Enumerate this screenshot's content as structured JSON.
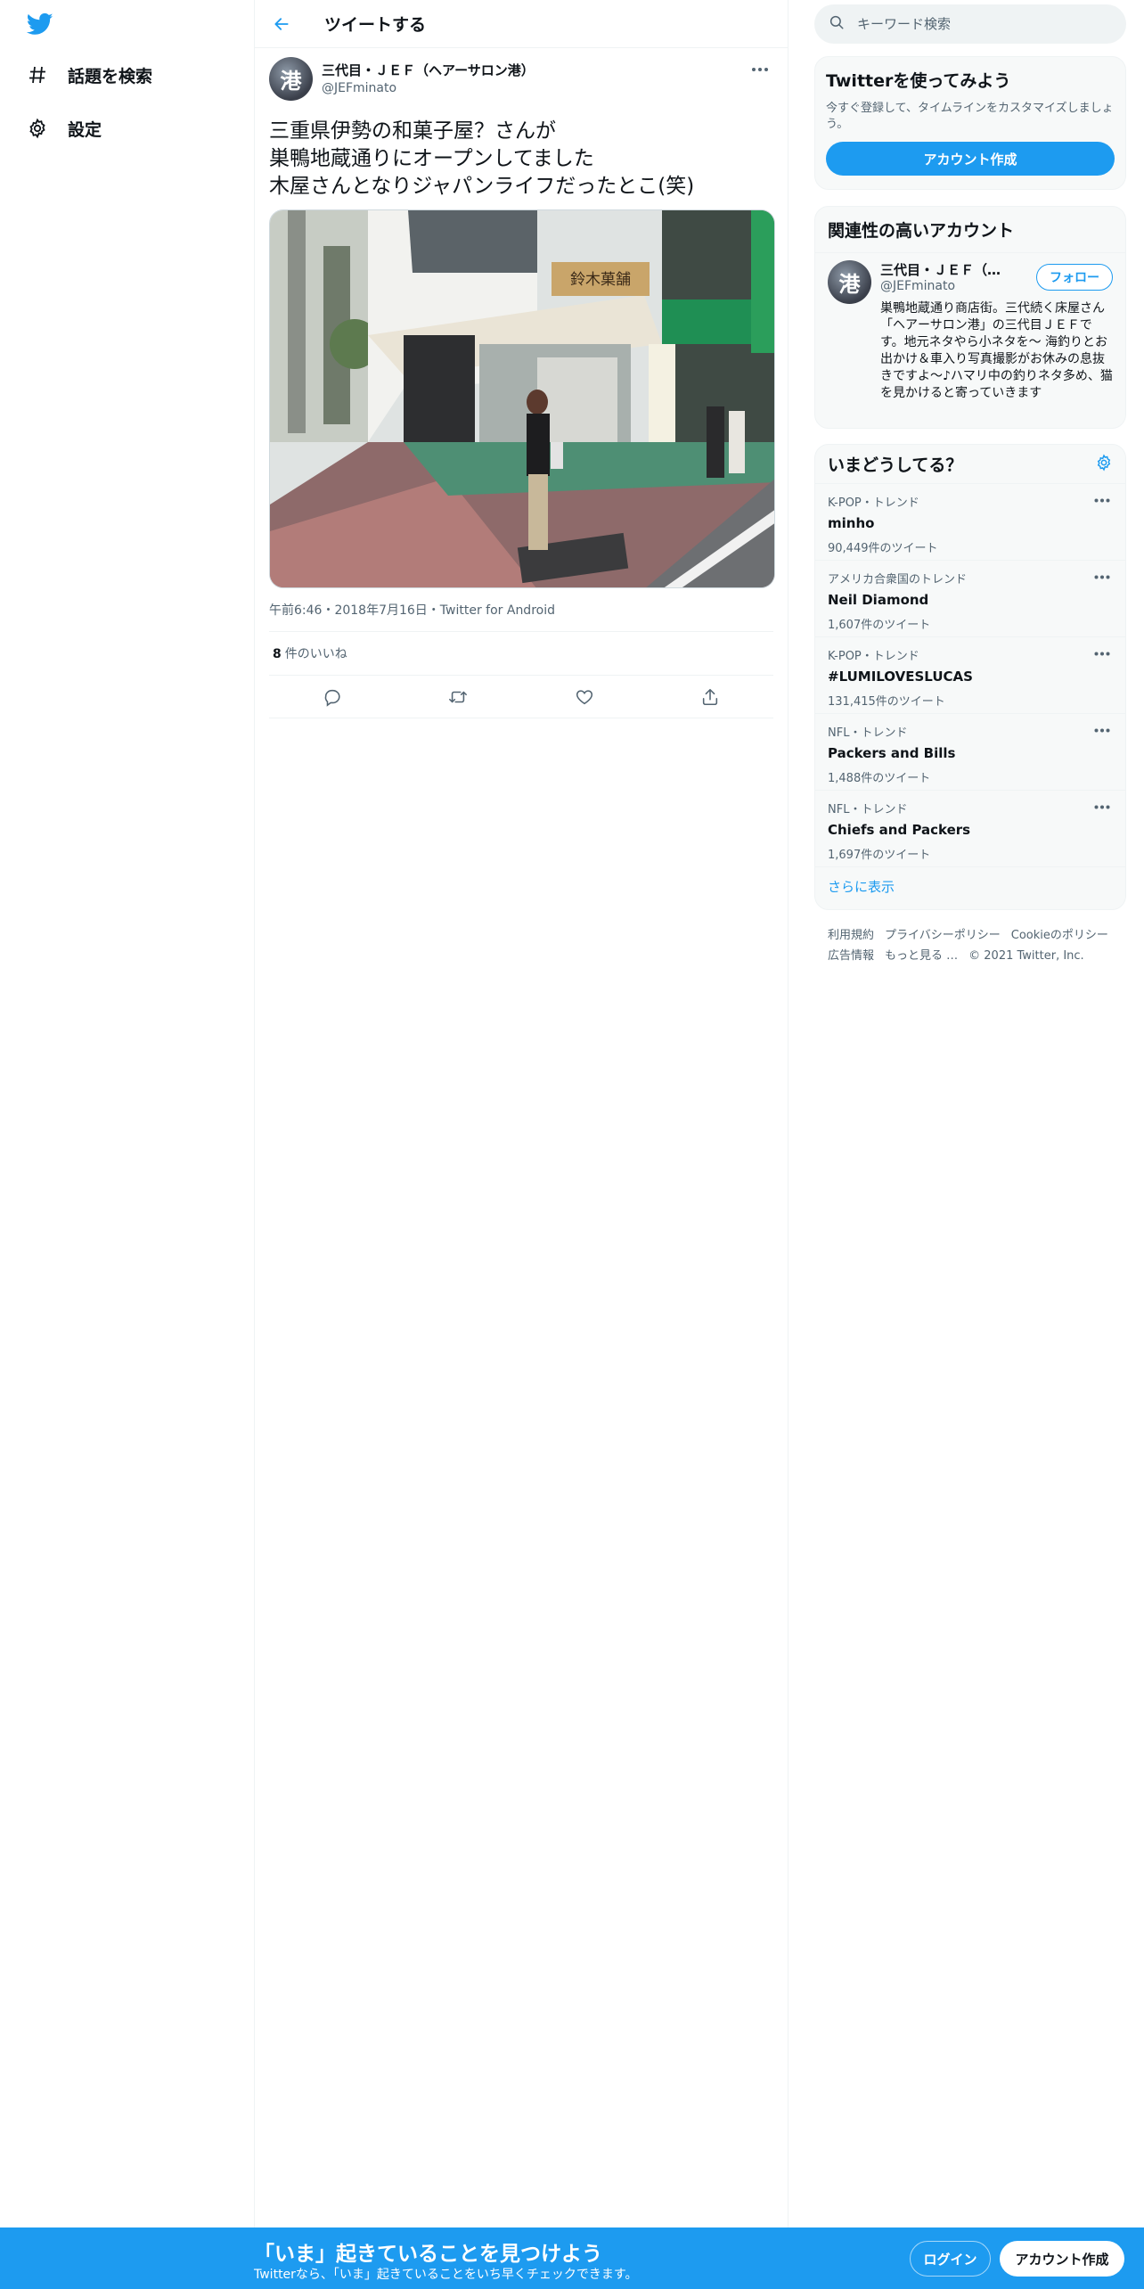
{
  "colors": {
    "accent": "#1d9bf0",
    "text": "#0f1419",
    "muted": "#536471",
    "border": "#eff3f4"
  },
  "nav": {
    "logo_icon": "twitter-bird-icon",
    "items": [
      {
        "icon": "hashtag-icon",
        "label": "話題を検索"
      },
      {
        "icon": "gear-icon",
        "label": "設定"
      }
    ]
  },
  "header": {
    "back_icon": "arrow-left-icon",
    "title": "ツイートする"
  },
  "tweet": {
    "avatar_text": "港",
    "display_name": "三代目・ＪＥＦ（ヘアーサロン港）",
    "handle": "@JEFminato",
    "text": "三重県伊勢の和菓子屋？さんが\n巣鴨地蔵通りにオープンしてました\n木屋さんとなりジャパンライフだったとこ(笑)",
    "photo_sign": "鈴木菓舗",
    "meta": "午前6:46・2018年7月16日・Twitter for Android",
    "likes_count": "8",
    "likes_label": "件のいいね",
    "actions": [
      "reply-icon",
      "retweet-icon",
      "like-icon",
      "share-icon"
    ]
  },
  "sidebar": {
    "search": {
      "placeholder": "キーワード検索"
    },
    "signup": {
      "title": "Twitterを使ってみよう",
      "desc": "今すぐ登録して、タイムラインをカスタマイズしましょう。",
      "button": "アカウント作成"
    },
    "related": {
      "title": "関連性の高いアカウント",
      "name": "三代目・ＪＥＦ（ヘアーサロン港）",
      "handle": "@JEFminato",
      "follow": "フォロー",
      "bio": "巣鴨地蔵通り商店街。三代続く床屋さん「ヘアーサロン港」の三代目ＪＥＦです。地元ネタやら小ネタを～ 海釣りとお出かけ＆車入り写真撮影がお休みの息抜きですよ～♪ハマリ中の釣りネタ多め、猫を見かけると寄っていきます"
    },
    "trends": {
      "title": "いまどうしてる？",
      "items": [
        {
          "context": "K-POP・トレンド",
          "name": "minho",
          "count": "90,449件のツイート"
        },
        {
          "context": "アメリカ合衆国のトレンド",
          "name": "Neil Diamond",
          "count": "1,607件のツイート"
        },
        {
          "context": "K-POP・トレンド",
          "name": "#LUMILOVESLUCAS",
          "count": "131,415件のツイート"
        },
        {
          "context": "NFL・トレンド",
          "name": "Packers and Bills",
          "count": "1,488件のツイート"
        },
        {
          "context": "NFL・トレンド",
          "name": "Chiefs and Packers",
          "count": "1,697件のツイート"
        }
      ],
      "show_more": "さらに表示"
    },
    "footer": {
      "links": [
        "利用規約",
        "プライバシーポリシー",
        "Cookieのポリシー",
        "広告情報",
        "もっと見る …"
      ],
      "copyright": "© 2021 Twitter, Inc."
    }
  },
  "bottom_bar": {
    "title": "「いま」起きていることを見つけよう",
    "subtitle": "Twitterなら、「いま」起きていることをいち早くチェックできます。",
    "login": "ログイン",
    "signup": "アカウント作成"
  }
}
